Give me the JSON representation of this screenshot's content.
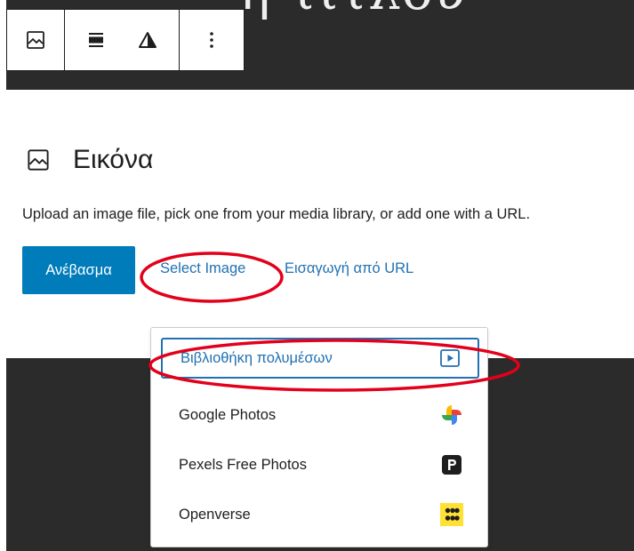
{
  "background": {
    "title_fragment": "η τίτλου"
  },
  "toolbar": {
    "buttons": [
      {
        "icon": "image-icon"
      },
      {
        "icon": "align-center-icon"
      },
      {
        "icon": "contrast-icon"
      },
      {
        "icon": "more-options-icon"
      }
    ]
  },
  "block": {
    "title": "Εικόνα",
    "icon": "image-icon",
    "instructions": "Upload an image file, pick one from your media library, or add one with a URL.",
    "upload_label": "Ανέβασμα",
    "select_image_label": "Select Image",
    "insert_url_label": "Εισαγωγή από URL"
  },
  "dropdown": {
    "items": [
      {
        "label": "Βιβλιοθήκη πολυμέσων",
        "icon": "media-library-icon",
        "active": true
      },
      {
        "label": "Google Photos",
        "icon": "google-photos-icon",
        "active": false
      },
      {
        "label": "Pexels Free Photos",
        "icon": "pexels-icon",
        "active": false
      },
      {
        "label": "Openverse",
        "icon": "openverse-icon",
        "active": false
      }
    ]
  },
  "colors": {
    "dark_background": "#2b2b2b",
    "primary_button": "#007cba",
    "link": "#2271b1",
    "annotation_red": "#e3001b",
    "openverse_yellow": "#ffe034"
  }
}
